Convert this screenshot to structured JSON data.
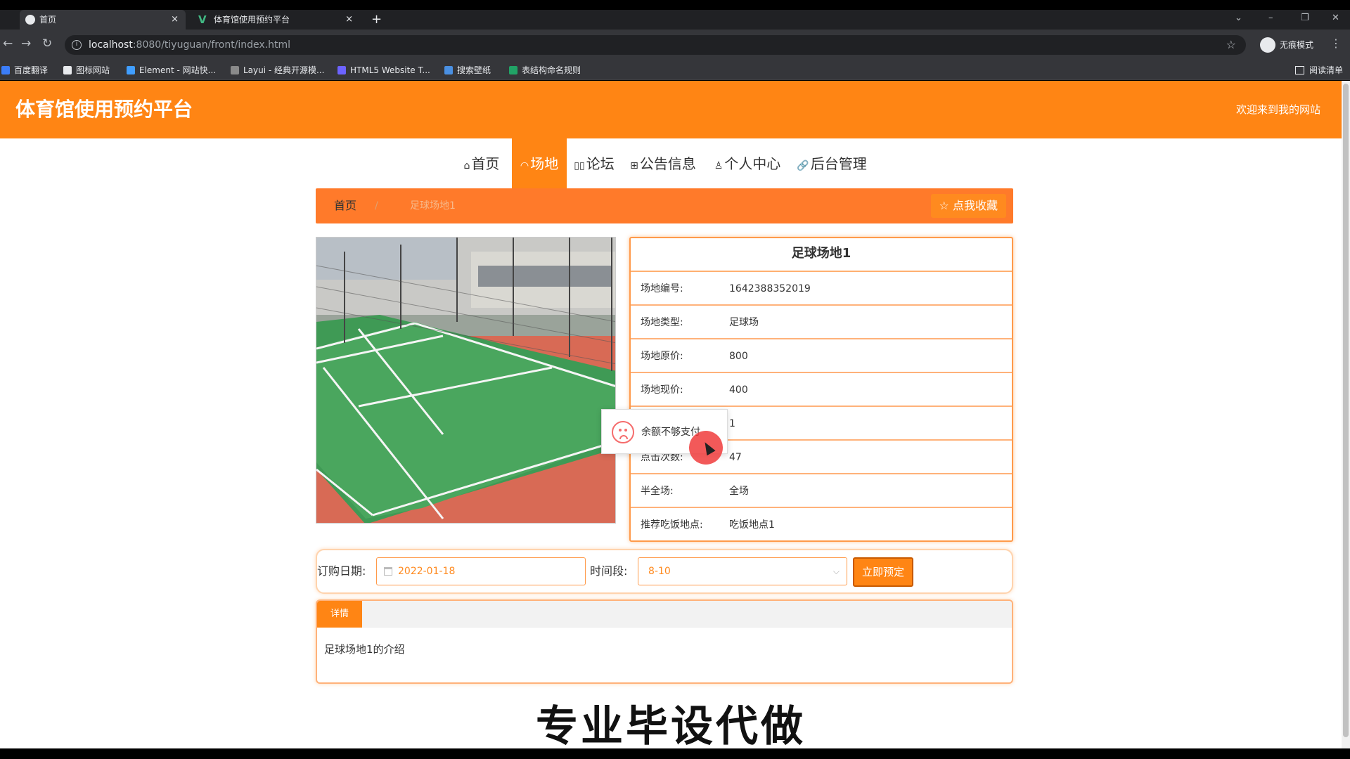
{
  "browser": {
    "tabs": [
      {
        "title": "首页",
        "active": true
      },
      {
        "title": "体育馆使用预约平台",
        "active": false
      }
    ],
    "new_tab": "+",
    "close_glyph": "×",
    "url_host": "localhost",
    "url_rest": ":8080/tiyuguan/front/index.html",
    "profile_label": "无痕模式",
    "bookmarks": [
      "百度翻译",
      "图标网站",
      "Element - 网站快...",
      "Layui - 经典开源模...",
      "HTML5 Website T...",
      "搜索壁纸",
      "表结构命名规则"
    ],
    "reader_label": "阅读清单"
  },
  "site": {
    "title": "体育馆使用预约平台",
    "welcome": "欢迎来到我的网站",
    "accent_color": "#ff8514"
  },
  "nav": [
    {
      "icon": "home-icon",
      "label": "首页",
      "active": false
    },
    {
      "icon": "venue-icon",
      "label": "场地",
      "active": true
    },
    {
      "icon": "forum-icon",
      "label": "论坛",
      "active": false
    },
    {
      "icon": "notice-icon",
      "label": "公告信息",
      "active": false
    },
    {
      "icon": "user-icon",
      "label": "个人中心",
      "active": false
    },
    {
      "icon": "link-icon",
      "label": "后台管理",
      "active": false
    }
  ],
  "breadcrumb": {
    "home": "首页",
    "separator": "/",
    "current": "足球场地1",
    "favorite_button": "点我收藏"
  },
  "venue": {
    "name": "足球场地1",
    "rows": [
      {
        "label": "场地编号:",
        "value": "1642388352019"
      },
      {
        "label": "场地类型:",
        "value": "足球场"
      },
      {
        "label": "场地原价:",
        "value": "800"
      },
      {
        "label": "场地现价:",
        "value": "400"
      },
      {
        "label": "",
        "value": "1"
      },
      {
        "label": "点击次数:",
        "value": "47"
      },
      {
        "label": "半全场:",
        "value": "全场"
      },
      {
        "label": "推荐吃饭地点:",
        "value": "吃饭地点1"
      }
    ]
  },
  "toast": {
    "message": "余额不够支付",
    "icon": "sad-face-icon"
  },
  "booking": {
    "date_label": "订购日期:",
    "date_value": "2022-01-18",
    "time_label": "时间段:",
    "time_value": "8-10",
    "submit_label": "立即预定"
  },
  "details": {
    "tab_label": "详情",
    "body": "足球场地1的介绍"
  },
  "watermark": "专业毕设代做"
}
